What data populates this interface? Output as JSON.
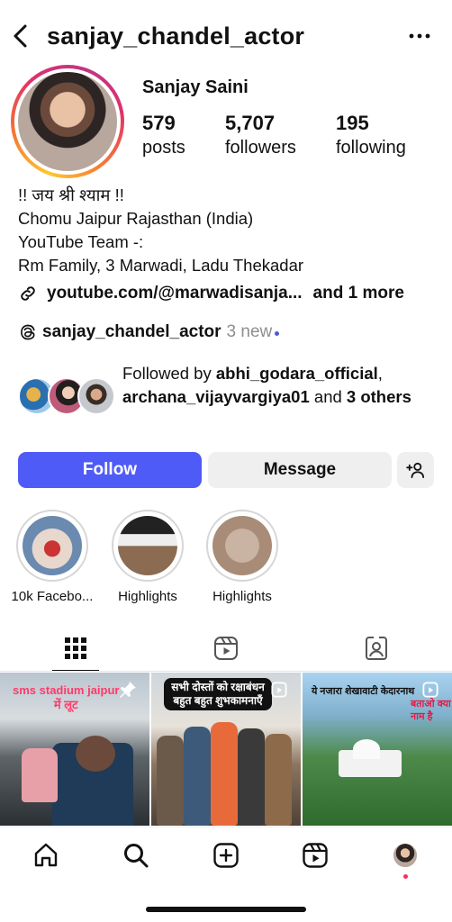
{
  "header": {
    "username": "sanjay_chandel_actor",
    "back_icon": "chevron-left-icon",
    "more_icon": "more-horizontal-icon"
  },
  "profile": {
    "display_name": "Sanjay Saini",
    "stats": [
      {
        "value": "579",
        "label": "posts"
      },
      {
        "value": "5,707",
        "label": "followers"
      },
      {
        "value": "195",
        "label": "following"
      }
    ],
    "bio_lines": [
      "!! जय श्री श्याम !!",
      "Chomu Jaipur Rajasthan (India)",
      "YouTube Team -:",
      "Rm Family, 3 Marwadi, Ladu Thekadar"
    ],
    "link": {
      "text": "youtube.com/@marwadisanja...",
      "more": "and 1 more"
    },
    "threads": {
      "handle": "sanjay_chandel_actor",
      "new_text": "3 new"
    },
    "followed_by": {
      "prefix": "Followed by ",
      "user1": "abhi_godara_official",
      "sep": ",",
      "user2": "archana_vijayvargiya01",
      "and": " and ",
      "others": "3 others"
    }
  },
  "actions": {
    "follow": "Follow",
    "message": "Message",
    "add_user_icon": "add-user-icon"
  },
  "highlights": [
    {
      "label": "10k  Facebo..."
    },
    {
      "label": "Highlights"
    },
    {
      "label": "Highlights"
    }
  ],
  "tabs": [
    {
      "name": "grid",
      "icon": "grid-icon",
      "active": true
    },
    {
      "name": "reels",
      "icon": "reels-icon",
      "active": false
    },
    {
      "name": "tagged",
      "icon": "tagged-icon",
      "active": false
    }
  ],
  "posts": [
    {
      "caption": "sms stadium jaipur",
      "caption2": "में लूट",
      "badge": "pin-icon"
    },
    {
      "caption": "सभी दोस्तों को रक्षाबंधन बहुत बहुत शुभकामनाएँ",
      "badge": "reel-badge-icon"
    },
    {
      "caption": "ये नजारा शेखावाटी केदारनाथ",
      "caption2": "बताओ क्या नाम है",
      "badge": "reel-badge-icon"
    }
  ],
  "nav": [
    {
      "name": "home",
      "icon": "home-icon"
    },
    {
      "name": "search",
      "icon": "search-icon"
    },
    {
      "name": "create",
      "icon": "plus-square-icon"
    },
    {
      "name": "reels",
      "icon": "reels-icon"
    },
    {
      "name": "profile",
      "icon": "profile-avatar"
    }
  ],
  "colors": {
    "follow_button": "#4f5bf7",
    "secondary_button": "#efefef",
    "link_dot": "#4f5bd5",
    "notification_dot": "#ff2d55"
  }
}
